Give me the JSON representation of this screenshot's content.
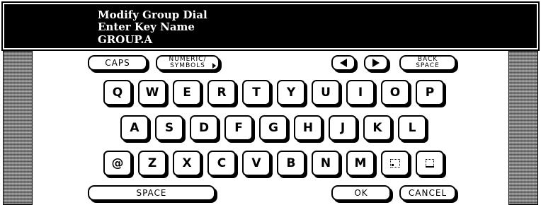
{
  "header": {
    "line1": "Modify Group Dial",
    "line2": "Enter Key Name",
    "line3": "GROUP.A"
  },
  "top_row": {
    "caps": "CAPS",
    "numeric_line1": "NUMERIC/",
    "numeric_line2": "SYMBOLS",
    "left_arrow_icon": "left-triangle-icon",
    "right_arrow_icon": "right-triangle-icon",
    "back_line1": "BACK",
    "back_line2": "SPACE"
  },
  "rows": {
    "row1": [
      "Q",
      "W",
      "E",
      "R",
      "T",
      "Y",
      "U",
      "I",
      "O",
      "P"
    ],
    "row2": [
      "A",
      "S",
      "D",
      "F",
      "G",
      "H",
      "J",
      "K",
      "L"
    ],
    "row3": [
      "@",
      "Z",
      "X",
      "C",
      "V",
      "B",
      "N",
      "M"
    ]
  },
  "row3_extra_icons": [
    "dot-space-icon",
    "underscore-icon"
  ],
  "bottom_row": {
    "space": "SPACE",
    "ok": "OK",
    "cancel": "CANCEL"
  }
}
